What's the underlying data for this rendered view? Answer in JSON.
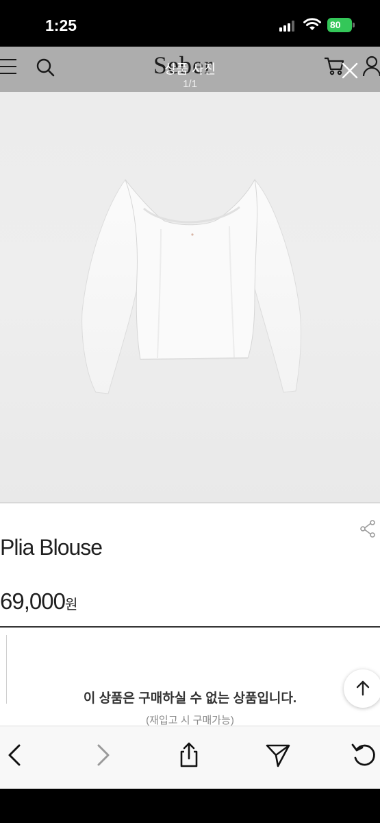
{
  "status_bar": {
    "time": "1:25",
    "battery_level": "80",
    "battery_color": "#34c759"
  },
  "site_header": {
    "brand": "Seber",
    "icons": [
      "menu-icon",
      "search-icon",
      "cart-icon",
      "user-icon"
    ]
  },
  "viewer": {
    "title": "상품 사진",
    "counter": "1/1",
    "close_icon": "close-icon"
  },
  "product": {
    "name": "Plia Blouse",
    "price_amount": "69,000",
    "price_unit": "원",
    "soldout_message": "이 상품은 구매하실 수 없는 상품입니다.",
    "restock_note": "(재입고 시 구매가능)"
  },
  "toolbar": {
    "icons": [
      "back-icon",
      "forward-icon",
      "share-icon",
      "send-icon",
      "reload-icon"
    ]
  }
}
